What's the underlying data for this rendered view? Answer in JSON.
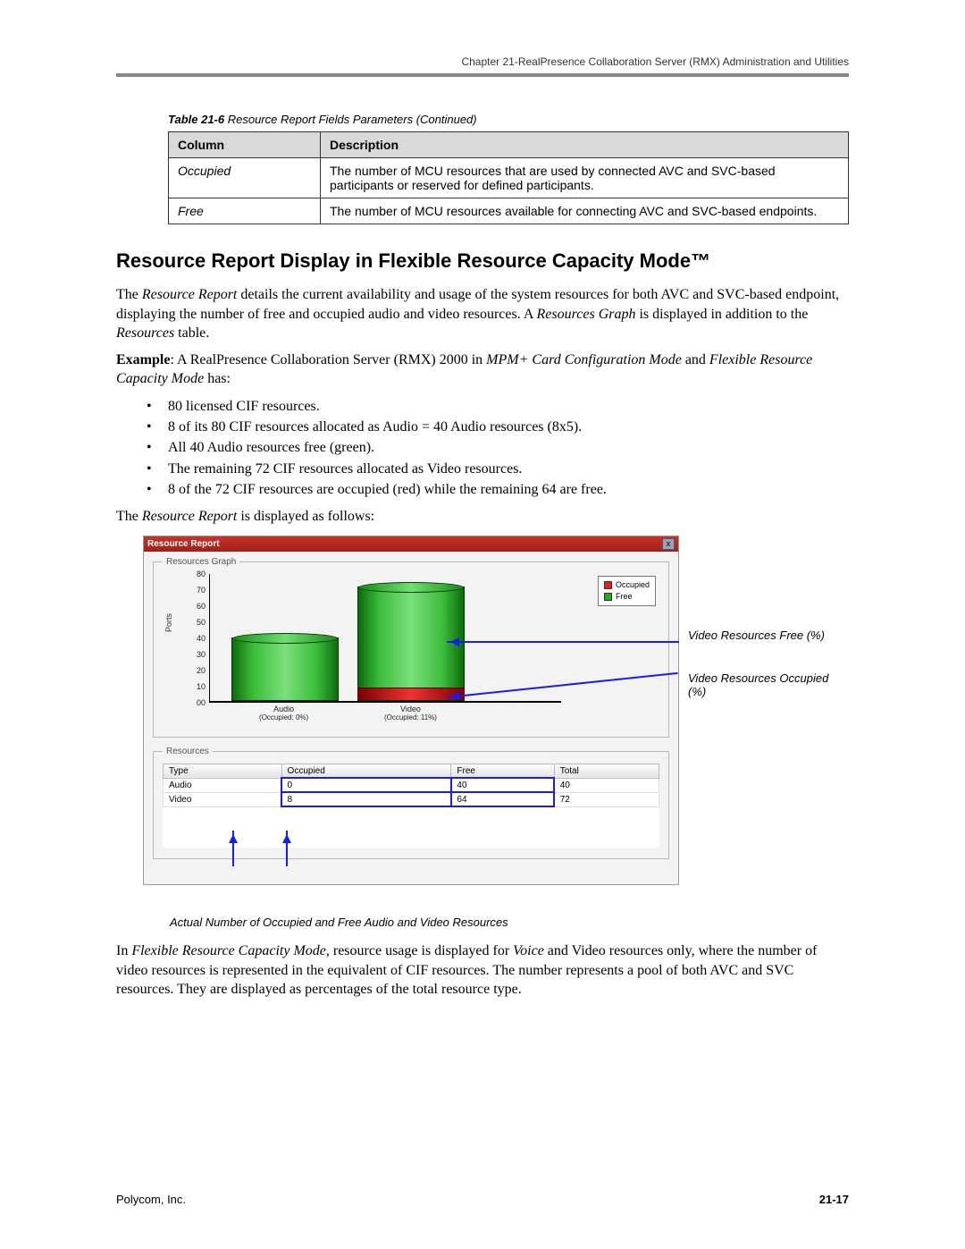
{
  "header": "Chapter 21-RealPresence Collaboration Server (RMX) Administration and Utilities",
  "table_caption_bold": "Table 21-6",
  "table_caption_rest": "  Resource Report Fields Parameters (Continued)",
  "table": {
    "head": {
      "c1": "Column",
      "c2": "Description"
    },
    "rows": [
      {
        "c1": "Occupied",
        "c2": "The number of MCU resources that are used by connected AVC and SVC-based participants or reserved for defined participants."
      },
      {
        "c1": "Free",
        "c2": "The number of MCU resources available for connecting AVC and SVC-based endpoints."
      }
    ]
  },
  "section_title": "Resource Report Display in Flexible Resource Capacity Mode™",
  "para1_a": "The ",
  "para1_b": "Resource Report",
  "para1_c": " details the current availability and usage of the system resources for both AVC and SVC-based endpoint, displaying the number of free and occupied audio and video resources. A ",
  "para1_d": "Resources Graph",
  "para1_e": " is displayed in addition to the ",
  "para1_f": "Resources",
  "para1_g": " table.",
  "para2_a": "Example",
  "para2_b": ": A RealPresence Collaboration Server (RMX) 2000 in ",
  "para2_c": "MPM+ Card Configuration Mode",
  "para2_d": " and ",
  "para2_e": "Flexible Resource Capacity Mode",
  "para2_f": " has:",
  "bul": {
    "b1a": "80 licensed ",
    "b1b": "CIF",
    "b1c": " resources.",
    "b2a": "8 of its 80 ",
    "b2b": "CIF",
    "b2c": " resources allocated as ",
    "b2d": "Audio",
    "b2e": " = 40 ",
    "b2f": "Audio",
    "b2g": " resources (8x5).",
    "b3a": "All 40 ",
    "b3b": "Audio",
    "b3c": " resources free (green).",
    "b4a": "The remaining 72 ",
    "b4b": "CIF",
    "b4c": " resources allocated as ",
    "b4d": "Video",
    "b4e": " resources.",
    "b5a": "8 of the 72 ",
    "b5b": "CIF",
    "b5c": " resources are occupied (red) while the remaining 64 are free."
  },
  "para3_a": "The ",
  "para3_b": "Resource Report",
  "para3_c": " is displayed as follows:",
  "rr": {
    "title": "Resource Report",
    "close": "x",
    "graph_legend": "Resources Graph",
    "res_legend": "Resources",
    "yaxis_label": "Ports",
    "legend_occ": "Occupied",
    "legend_free": "Free",
    "xl_audio": "Audio",
    "xl_audio_sub": "(Occupied: 0%)",
    "xl_video": "Video",
    "xl_video_sub": "(Occupied: 11%)",
    "rt_head": {
      "c1": "Type",
      "c2": "Occupied",
      "c3": "Free",
      "c4": "Total"
    },
    "rt_rows": [
      {
        "c1": "Audio",
        "c2": "0",
        "c3": "40",
        "c4": "40"
      },
      {
        "c1": "Video",
        "c2": "8",
        "c3": "64",
        "c4": "72"
      }
    ]
  },
  "callout_free": "Video Resources Free (%)",
  "callout_occ": "Video Resources Occupied (%)",
  "fig_caption": "Actual Number of Occupied and Free Audio and Video Resources",
  "para4_a": "In ",
  "para4_b": "Flexible Resource Capacity Mode,",
  "para4_c": " resource usage is displayed for ",
  "para4_d": "Voice",
  "para4_e": " and Video resources only, where the number of video resources is represented in the equivalent of CIF resources. The number represents a pool of both AVC and SVC resources. They are displayed as percentages of the total resource type.",
  "footer_left": "Polycom, Inc.",
  "footer_right": "21-17",
  "chart_data": {
    "type": "bar",
    "title": "Resources Graph",
    "ylabel": "Ports",
    "ylim": [
      0,
      80
    ],
    "y_ticks": [
      0,
      10,
      20,
      30,
      40,
      50,
      60,
      70,
      80
    ],
    "categories": [
      "Audio",
      "Video"
    ],
    "series": [
      {
        "name": "Occupied",
        "values": [
          0,
          8
        ]
      },
      {
        "name": "Free",
        "values": [
          40,
          64
        ]
      }
    ],
    "occupied_pct": {
      "Audio": 0,
      "Video": 11
    }
  }
}
